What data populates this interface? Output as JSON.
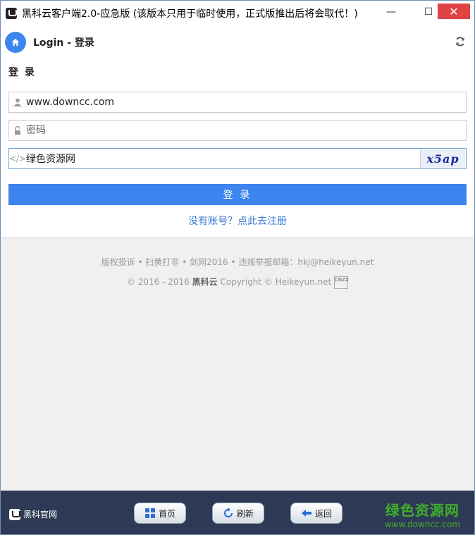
{
  "window": {
    "title": "黑科云客户端2.0-应急版 (该版本只用于临时使用，正式版推出后将会取代！)",
    "minimize": "—",
    "maximize": "☐",
    "close": "✕"
  },
  "header": {
    "title": "Login - 登录"
  },
  "form": {
    "section_title": "登 录",
    "username_value": "www.downcc.com",
    "password_placeholder": "密码",
    "captcha_value": "绿色资源网",
    "captcha_image_text": "x5ap",
    "login_label": "登 录",
    "register_link": "没有账号？点此去注册"
  },
  "footer": {
    "line1": "版权投诉 • 扫黄打非 • 剑网2016 • 违规举报邮箱：hkj@heikeyun.net",
    "line2_prefix": "© 2016 - 2016",
    "line2_brand": "黑科云",
    "line2_suffix": "Copyright © Heikeyun.net",
    "cnzz": "CNZZ"
  },
  "bottom": {
    "brand": "黑科官网",
    "home": "首页",
    "refresh": "刷新",
    "back": "返回"
  },
  "watermark": {
    "big": "绿色资源网",
    "small": "www.downcc.com"
  },
  "colors": {
    "accent": "#3d84ef",
    "bottom_bar": "#2e3a55",
    "close": "#e04343",
    "link": "#3a7bd5"
  }
}
